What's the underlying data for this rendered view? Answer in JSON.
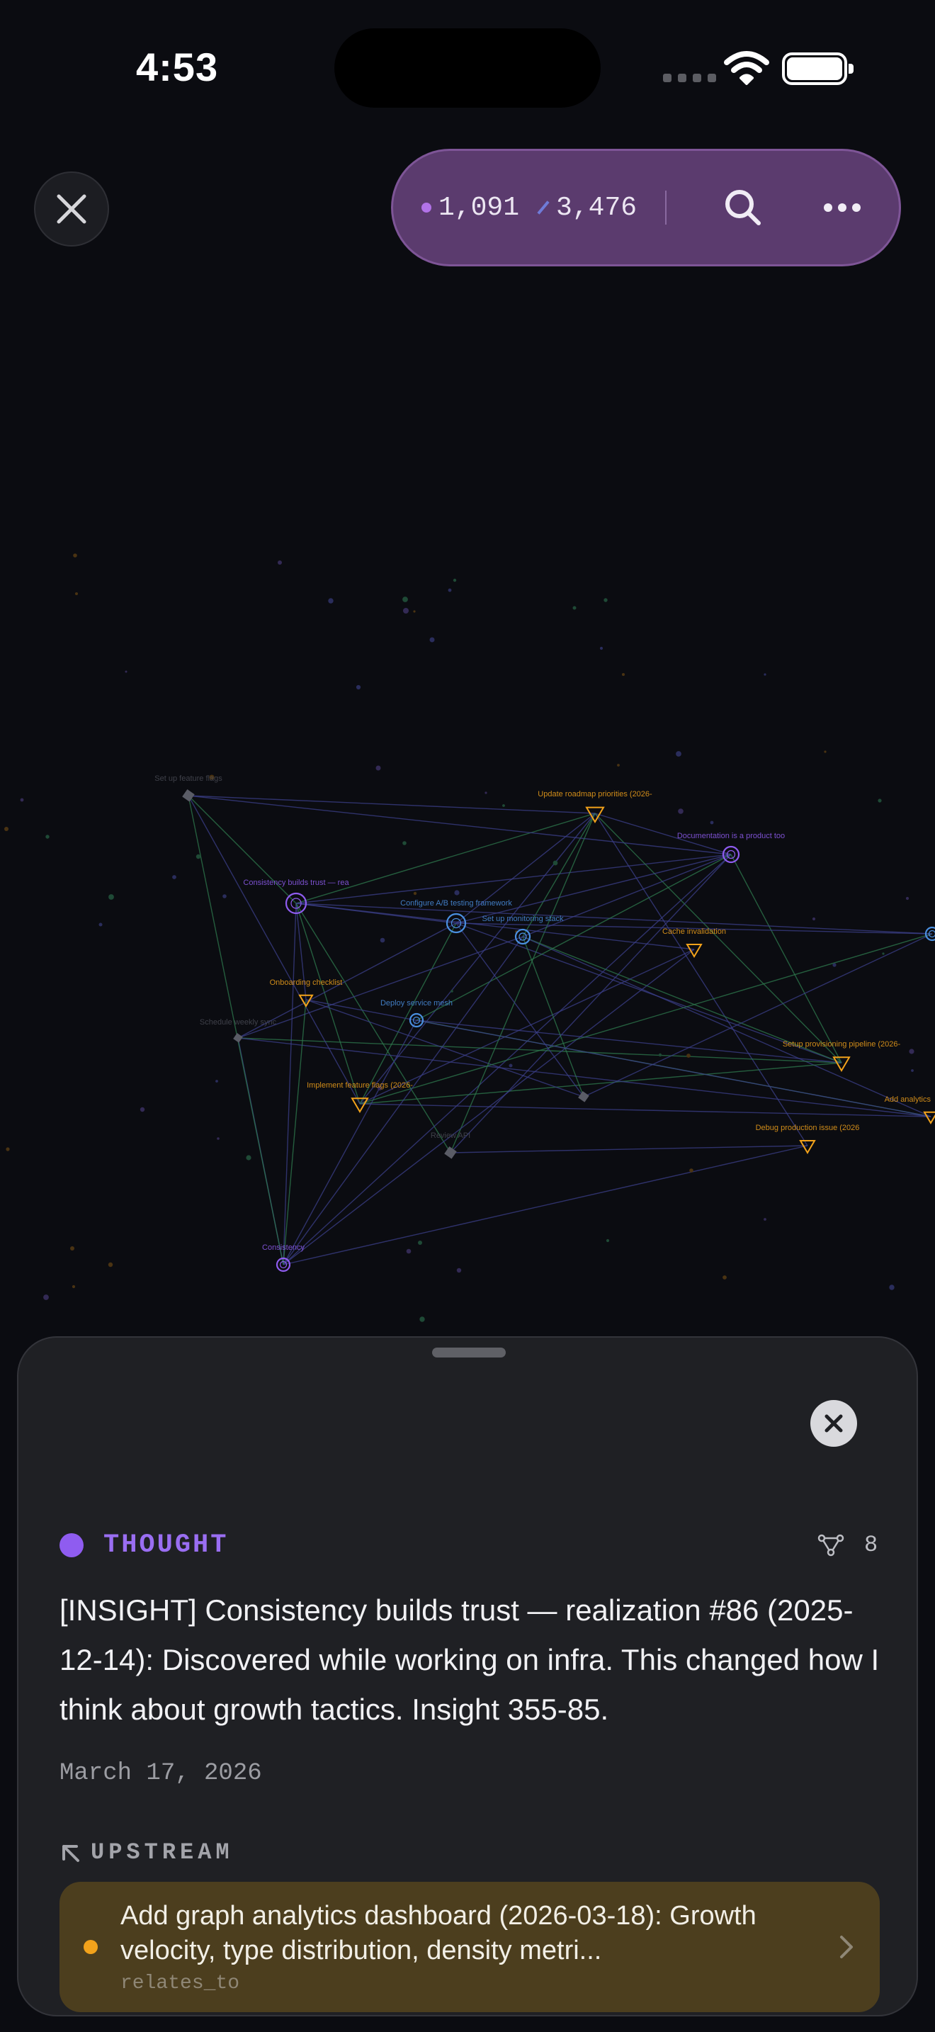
{
  "status_bar": {
    "time": "4:53"
  },
  "toolbar": {
    "node_count": "1,091",
    "edge_count": "3,476",
    "search_icon": "search-icon",
    "more_icon": "ellipsis-icon"
  },
  "graph": {
    "node_labels": [
      "Consistency builds trust — rea",
      "Update roadmap priorities (2026-",
      "Documentation is a product too",
      "Configure A/B testing framework",
      "Set up monitoring stack",
      "Implement feature flags (2026-",
      "Setup provisioning pipeline (2026-",
      "Debug production issue (2026",
      "Add analytics",
      "Consistency",
      "Set up feature flags",
      "Schedule weekly sync",
      "Onboarding checklist",
      "Deploy service mesh",
      "Review API",
      "Cache invalidation"
    ],
    "colors": {
      "thought": "#8f5cf0",
      "task": "#f2a21b",
      "note": "#4a8fe0",
      "edge": "#3b3f8a",
      "edge_green": "#2e7a4e"
    }
  },
  "sheet": {
    "type_label": "THOUGHT",
    "type_color": "#8f5cf0",
    "connection_count": "8",
    "body": "[INSIGHT] Consistency builds trust — realization #86 (2025-12-14): Discovered while working on infra. This changed how I think about growth tactics. Insight 355-85.",
    "date": "March 17, 2026",
    "upstream_label": "UPSTREAM",
    "upstream": [
      {
        "title": "Add graph analytics dashboard (2026-03-18): Growth velocity, type distribution, density metri...",
        "relation": "relates_to",
        "color": "#f2a21b"
      }
    ]
  }
}
